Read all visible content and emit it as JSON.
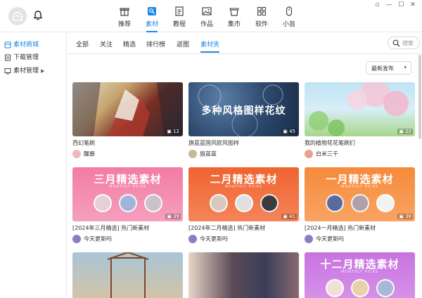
{
  "window": {
    "controls": [
      "▫",
      "—",
      "☐",
      "✕"
    ]
  },
  "nav": {
    "items": [
      {
        "label": "推荐",
        "icon": "recommend-icon",
        "active": false
      },
      {
        "label": "素材",
        "icon": "material-icon",
        "active": true
      },
      {
        "label": "教程",
        "icon": "tutorial-icon",
        "active": false
      },
      {
        "label": "作品",
        "icon": "artwork-icon",
        "active": false
      },
      {
        "label": "集市",
        "icon": "market-icon",
        "active": false
      },
      {
        "label": "软件",
        "icon": "software-icon",
        "active": false
      },
      {
        "label": "小旨",
        "icon": "assistant-icon",
        "active": false
      }
    ]
  },
  "sidebar": {
    "items": [
      {
        "label": "素材商城",
        "icon": "store-icon",
        "active": true
      },
      {
        "label": "下载管理",
        "icon": "download-icon",
        "active": false
      },
      {
        "label": "素材管理",
        "icon": "manage-icon",
        "active": false,
        "expandable": true
      }
    ]
  },
  "tabs": {
    "items": [
      "全部",
      "关注",
      "精选",
      "排行榜",
      "返图",
      "素材夹"
    ],
    "active_index": 5
  },
  "search": {
    "placeholder": "搜索"
  },
  "sort": {
    "value": "最新发布",
    "caret": "▾"
  },
  "colors": {
    "accent": "#1e88e5"
  },
  "cards": [
    {
      "title": "西幻笔刷",
      "author": "醒鹿",
      "count": "12",
      "thumb_text": "",
      "thumb_sub": ""
    },
    {
      "title": "旗蓝蓝国风欧风图样",
      "author": "旗蓝蓝",
      "count": "45",
      "thumb_text": "多种风格图样花纹",
      "thumb_sub": ""
    },
    {
      "title": "我的植物花花笔刷们",
      "author": "白米三千",
      "count": "22",
      "thumb_text": "",
      "thumb_sub": ""
    },
    {
      "title": "[2024年三月精选] 热门新素材",
      "author": "今天更新吗",
      "count": "39",
      "thumb_text": "三月精选素材",
      "thumb_sub": "MONTHLY PICKS"
    },
    {
      "title": "[2024年二月精选] 热门新素材",
      "author": "今天更新吗",
      "count": "41",
      "thumb_text": "二月精选素材",
      "thumb_sub": "MONTHLY PICKS"
    },
    {
      "title": "[2024一月精选] 热门新素材",
      "author": "今天更新吗",
      "count": "38",
      "thumb_text": "一月精选素材",
      "thumb_sub": "MONTHLY PICKS"
    },
    {
      "title": "",
      "author": "",
      "count": "",
      "thumb_text": "",
      "thumb_sub": ""
    },
    {
      "title": "",
      "author": "",
      "count": "",
      "thumb_text": "",
      "thumb_sub": ""
    },
    {
      "title": "",
      "author": "",
      "count": "",
      "thumb_text": "十二月精选素材",
      "thumb_sub": "MONTHLY PICKS"
    }
  ]
}
